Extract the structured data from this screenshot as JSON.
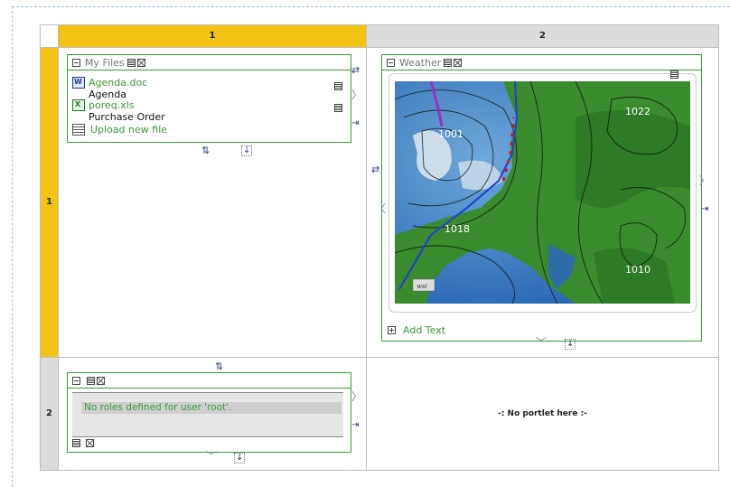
{
  "layout": {
    "columns": [
      "1",
      "2"
    ],
    "rows": [
      "1",
      "2"
    ]
  },
  "my_files": {
    "title": "My Files",
    "files": [
      {
        "name": "Agenda.doc",
        "description": "Agenda",
        "type": "word"
      },
      {
        "name": "poreq.xls",
        "description": "Purchase Order",
        "type": "excel"
      }
    ],
    "upload_label": "Upload new file"
  },
  "weather": {
    "title": "Weather",
    "pressure_labels": [
      "1022",
      "1001",
      "1018",
      "1010"
    ],
    "watermark": "wsi",
    "add_text_label": "Add Text"
  },
  "roles": {
    "message": "No roles defined for user 'root'."
  },
  "empty_cell": {
    "text": "-: No portlet here :-"
  },
  "icons": [
    "minimize-icon",
    "edit-icon",
    "close-icon",
    "swap-horizontal-icon",
    "swap-vertical-icon",
    "move-down-icon",
    "chevron-right-icon",
    "chevron-left-icon",
    "chevron-down-icon",
    "move-right-icon",
    "plus-icon",
    "properties-icon",
    "word-file-icon",
    "excel-file-icon",
    "upload-icon"
  ],
  "colors": {
    "accent_yellow": "#f2c313",
    "header_gray": "#dcdcdc",
    "portlet_border": "#3a9a3a",
    "link_green": "#3a9a3a"
  }
}
